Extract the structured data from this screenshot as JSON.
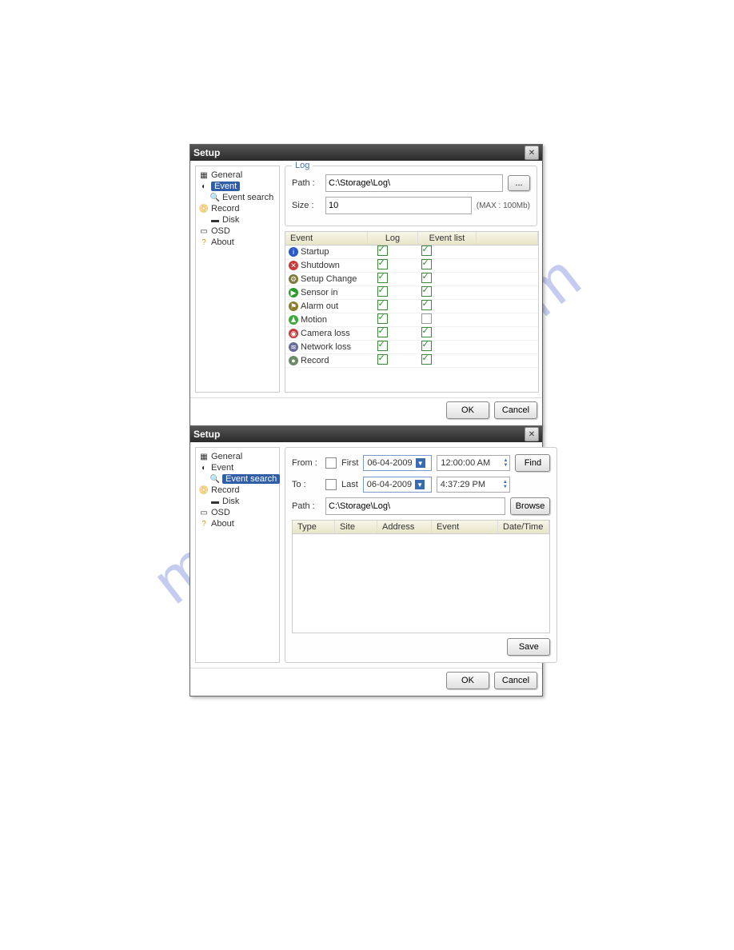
{
  "watermark": "manualshive.com",
  "dialog1": {
    "title": "Setup",
    "tree": {
      "general": "General",
      "event": "Event",
      "event_search": "Event search",
      "record": "Record",
      "disk": "Disk",
      "osd": "OSD",
      "about": "About",
      "selected": "event"
    },
    "log": {
      "group_title": "Log",
      "path_label": "Path :",
      "path_value": "C:\\Storage\\Log\\",
      "browse_label": "...",
      "size_label": "Size :",
      "size_value": "10",
      "max_hint": "(MAX : 100Mb)"
    },
    "event_table": {
      "headers": {
        "event": "Event",
        "log": "Log",
        "list": "Event list"
      },
      "rows": [
        {
          "icon": "info-icon",
          "color": "#2a5ac8",
          "glyph": "i",
          "name": "Startup",
          "log": true,
          "list": true
        },
        {
          "icon": "stop-icon",
          "color": "#c83a3a",
          "glyph": "✕",
          "name": "Shutdown",
          "log": true,
          "list": true
        },
        {
          "icon": "gear-icon",
          "color": "#7a7a3a",
          "glyph": "⚙",
          "name": "Setup Change",
          "log": true,
          "list": true
        },
        {
          "icon": "sensor-icon",
          "color": "#2a9a2a",
          "glyph": "▶",
          "name": "Sensor in",
          "log": true,
          "list": true
        },
        {
          "icon": "alarm-icon",
          "color": "#8a7a2a",
          "glyph": "⚑",
          "name": "Alarm out",
          "log": true,
          "list": true
        },
        {
          "icon": "motion-icon",
          "color": "#3aaa3a",
          "glyph": "♟",
          "name": "Motion",
          "log": true,
          "list": false
        },
        {
          "icon": "camera-icon",
          "color": "#c83a3a",
          "glyph": "◉",
          "name": "Camera loss",
          "log": true,
          "list": true
        },
        {
          "icon": "network-icon",
          "color": "#6a6a9a",
          "glyph": "≋",
          "name": "Network loss",
          "log": true,
          "list": true
        },
        {
          "icon": "record-icon",
          "color": "#6a8a6a",
          "glyph": "●",
          "name": "Record",
          "log": true,
          "list": true
        }
      ]
    },
    "buttons": {
      "ok": "OK",
      "cancel": "Cancel"
    }
  },
  "dialog2": {
    "title": "Setup",
    "tree": {
      "general": "General",
      "event": "Event",
      "event_search": "Event search",
      "record": "Record",
      "disk": "Disk",
      "osd": "OSD",
      "about": "About",
      "selected": "event_search"
    },
    "search": {
      "from_label": "From :",
      "to_label": "To :",
      "first_label": "First",
      "last_label": "Last",
      "from_date": "06-04-2009",
      "to_date": "06-04-2009",
      "from_time": "12:00:00 AM",
      "to_time": "4:37:29 PM",
      "path_label": "Path :",
      "path_value": "C:\\Storage\\Log\\",
      "find_label": "Find",
      "browse_label": "Browse"
    },
    "results": {
      "headers": {
        "type": "Type",
        "site": "Site",
        "address": "Address",
        "event": "Event",
        "datetime": "Date/Time"
      }
    },
    "buttons": {
      "save": "Save",
      "ok": "OK",
      "cancel": "Cancel"
    }
  }
}
